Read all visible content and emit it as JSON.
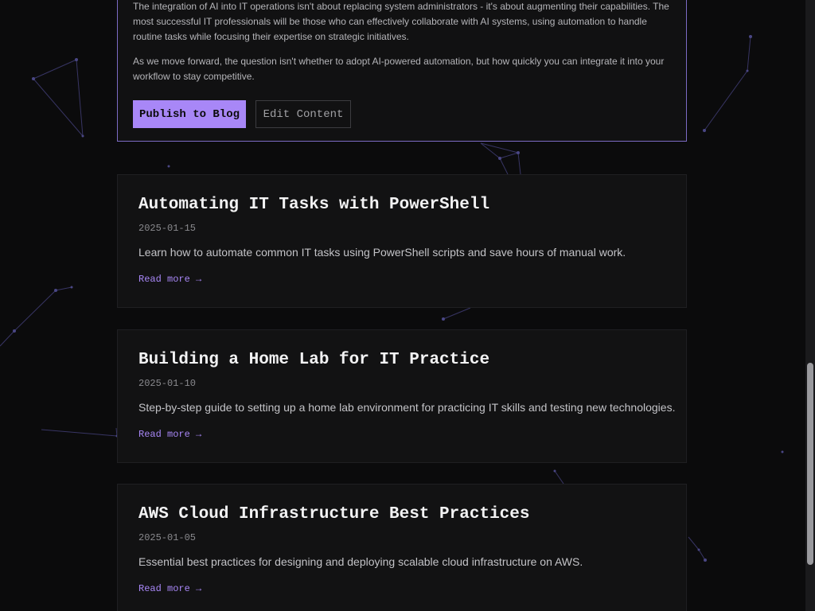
{
  "generated": {
    "paragraphs": [
      "The integration of AI into IT operations isn't about replacing system administrators - it's about augmenting their capabilities. The most successful IT professionals will be those who can effectively collaborate with AI systems, using automation to handle routine tasks while focusing their expertise on strategic initiatives.",
      "As we move forward, the question isn't whether to adopt AI-powered automation, but how quickly you can integrate it into your workflow to stay competitive."
    ],
    "publish_label": "Publish to Blog",
    "edit_label": "Edit Content"
  },
  "posts": [
    {
      "title": "Automating IT Tasks with PowerShell",
      "date": "2025-01-15",
      "excerpt": "Learn how to automate common IT tasks using PowerShell scripts and save hours of manual work.",
      "link": "Read more →"
    },
    {
      "title": "Building a Home Lab for IT Practice",
      "date": "2025-01-10",
      "excerpt": "Step-by-step guide to setting up a home lab environment for practicing IT skills and testing new technologies.",
      "link": "Read more →"
    },
    {
      "title": "AWS Cloud Infrastructure Best Practices",
      "date": "2025-01-05",
      "excerpt": "Essential best practices for designing and deploying scalable cloud infrastructure on AWS.",
      "link": "Read more →"
    }
  ],
  "colors": {
    "background": "#0b0b0c",
    "card": "#121213",
    "accent": "#a887f7",
    "border_accent": "#7c6bc4",
    "network_line": "#3d3a6e"
  },
  "scroll": {
    "thumb_position_fraction": 0.73
  }
}
